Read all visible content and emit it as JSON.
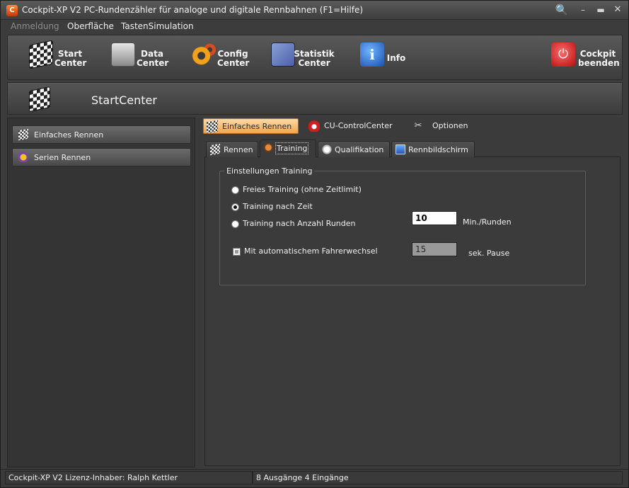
{
  "window": {
    "title": "Cockpit-XP V2 PC-Rundenzähler für analoge und digitale Rennbahnen (F1=Hilfe)",
    "app_icon_text": "C",
    "search_icon": "magnifier-icon",
    "min_glyph": "–",
    "max_glyph": "▬",
    "close_glyph": "✕"
  },
  "menu": {
    "items": [
      "Anmeldung",
      "Oberfläche",
      "TastenSimulation"
    ]
  },
  "toolbar": {
    "start": "Start\nCenter",
    "data": "Data\nCenter",
    "config": "Config\nCenter",
    "statistik": "Statistik\nCenter",
    "info": "Info",
    "beenden": "Cockpit\nbeenden",
    "info_glyph": "i",
    "power_glyph": "⏻"
  },
  "header": {
    "title": "StartCenter"
  },
  "sidebar": {
    "items": [
      {
        "label": "Einfaches Rennen",
        "icon": "checkered-flag-icon"
      },
      {
        "label": "Serien Rennen",
        "icon": "series-icon"
      }
    ]
  },
  "top_tabs": {
    "items": [
      {
        "label": "Einfaches Rennen",
        "icon": "checkered-flag-icon",
        "active": true
      },
      {
        "label": "CU-ControlCenter",
        "icon": "control-unit-icon",
        "active": false
      },
      {
        "label": "Optionen",
        "icon": "tools-icon",
        "active": false
      }
    ],
    "tools_glyph": "✂"
  },
  "sub_tabs": {
    "items": [
      {
        "label": "Rennen",
        "icon": "checkered-flag-icon"
      },
      {
        "label": "Training",
        "icon": "helmet-icon"
      },
      {
        "label": "Qualifikation",
        "icon": "clock-icon"
      },
      {
        "label": "Rennbildschirm",
        "icon": "monitor-icon"
      }
    ],
    "active": "Training"
  },
  "training": {
    "group_title": "Einstellungen Training",
    "option_free": "Freies Training (ohne Zeitlimit)",
    "option_time": "Training nach Zeit",
    "option_laps": "Training nach Anzahl Runden",
    "selected_option": "Training nach Zeit",
    "limit_value": "10",
    "limit_unit": "Min./Runden",
    "driver_change_label": "Mit automatischem Fahrerwechsel",
    "driver_change_checked": false,
    "pause_value": "15",
    "pause_unit": "sek. Pause"
  },
  "status": {
    "license": "Cockpit-XP V2 Lizenz-Inhaber: Ralph Kettler",
    "io": "8 Ausgänge 4 Eingänge"
  }
}
